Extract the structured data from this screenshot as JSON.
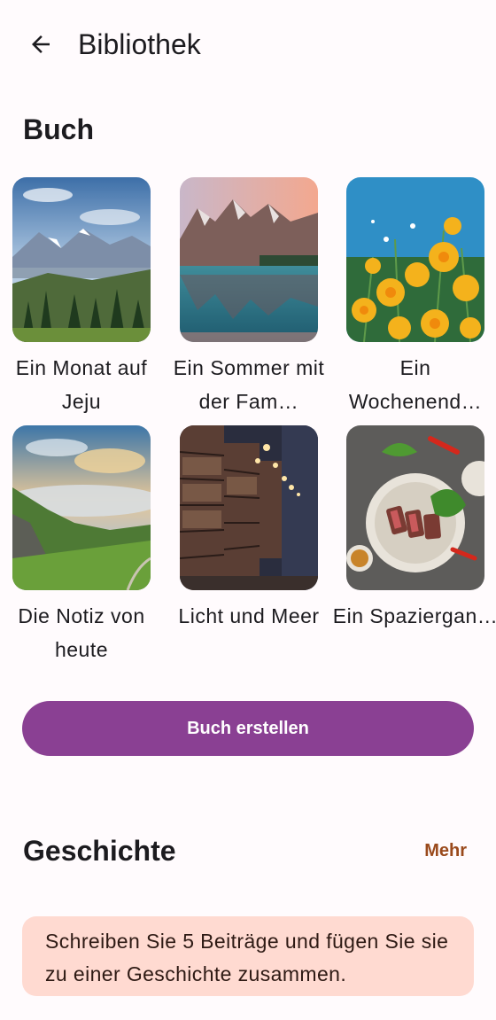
{
  "header": {
    "title": "Bibliothek",
    "back_icon": "arrow-back-icon"
  },
  "books_section": {
    "title": "Buch",
    "items": [
      {
        "title": "Ein Monat auf Jeju",
        "cover": "mountain-valley-forest"
      },
      {
        "title": "Ein Sommer mit der Fam…",
        "cover": "mountain-lake-reflection"
      },
      {
        "title": "Ein Wochenend…",
        "cover": "yellow-poppies"
      },
      {
        "title": "Die Notiz von heute",
        "cover": "green-cliffs-sunset"
      },
      {
        "title": "Licht und Meer",
        "cover": "library-bookshelves"
      },
      {
        "title": "Ein Spaziergan…",
        "cover": "steak-dinner"
      }
    ],
    "create_button": "Buch erstellen"
  },
  "story_section": {
    "title": "Geschichte",
    "more_link": "Mehr",
    "info_text": "Schreiben Sie 5 Beiträge und fügen Sie sie zu einer Geschichte zusammen."
  },
  "colors": {
    "primary": "#8a4093",
    "link": "#9a4a1c",
    "info_bg": "#ffdad1",
    "background": "#fffbfd"
  }
}
